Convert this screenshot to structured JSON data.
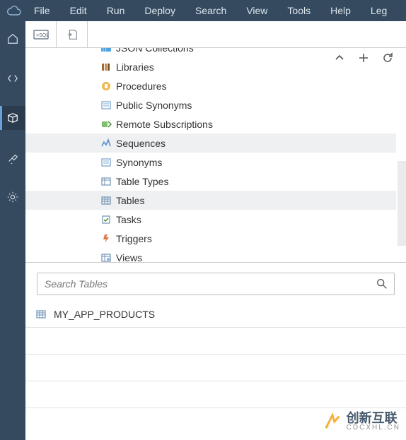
{
  "menu": {
    "items": [
      "File",
      "Edit",
      "Run",
      "Deploy",
      "Search",
      "View",
      "Tools",
      "Help",
      "Leg"
    ]
  },
  "sidebar": {
    "icons": [
      "home-icon",
      "code-icon",
      "package-icon",
      "pin-icon",
      "gear-icon"
    ],
    "active": 2
  },
  "toolbar": {
    "buttons": [
      "sql-icon",
      "file-out-icon"
    ]
  },
  "tree": {
    "items": [
      {
        "icon": "json-icon",
        "label": "JSON Collections",
        "state": ""
      },
      {
        "icon": "library-icon",
        "label": "Libraries",
        "state": ""
      },
      {
        "icon": "procedure-icon",
        "label": "Procedures",
        "state": ""
      },
      {
        "icon": "synonym-icon",
        "label": "Public Synonyms",
        "state": ""
      },
      {
        "icon": "remote-icon",
        "label": "Remote Subscriptions",
        "state": ""
      },
      {
        "icon": "sequence-icon",
        "label": "Sequences",
        "state": "highlight"
      },
      {
        "icon": "synonym-icon",
        "label": "Synonyms",
        "state": ""
      },
      {
        "icon": "tabletype-icon",
        "label": "Table Types",
        "state": ""
      },
      {
        "icon": "table-icon",
        "label": "Tables",
        "state": "selected"
      },
      {
        "icon": "task-icon",
        "label": "Tasks",
        "state": ""
      },
      {
        "icon": "trigger-icon",
        "label": "Triggers",
        "state": ""
      },
      {
        "icon": "view-icon",
        "label": "Views",
        "state": ""
      }
    ]
  },
  "search": {
    "placeholder": "Search Tables"
  },
  "results": {
    "rows": [
      {
        "icon": "table-icon",
        "label": "MY_APP_PRODUCTS"
      }
    ],
    "empty_rows": 3
  },
  "watermark": {
    "text": "创新互联",
    "sub": "CDCXHL.CN"
  },
  "colors": {
    "menu_bg": "#354a5f",
    "accent": "#6aa0d8"
  }
}
